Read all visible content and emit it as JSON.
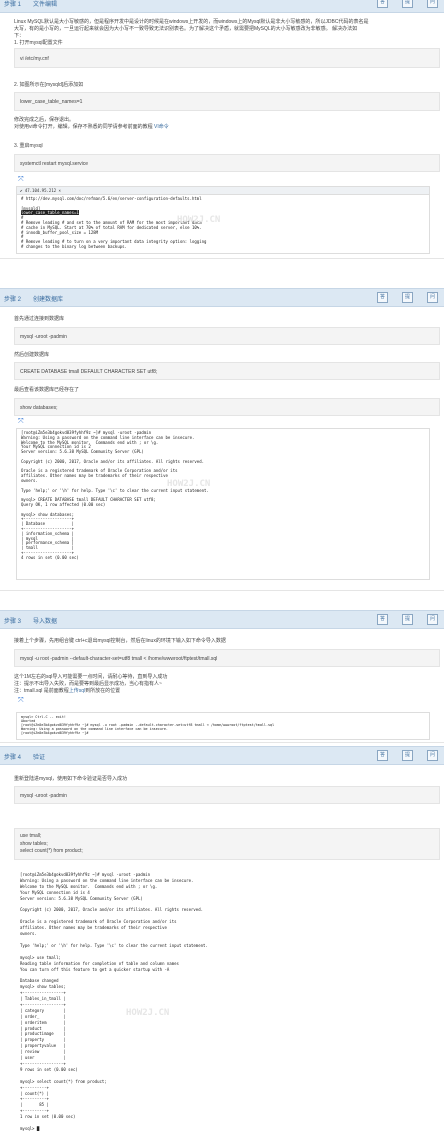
{
  "step1": {
    "num": "步骤 1",
    "title": "文件编辑",
    "lines": [
      "Linux MySQL默认是大小写敏感的，但是程序开发中是设计的时候是在windows上开发的，而windows上的Mysql默认是非大小写敏感的，所以JDBC代码的表名是",
      "大写，有的是小写的，一旦运行起来就会因为大小写不一致导致无法识别表名。为了解决这个矛盾，就需要把MySQL的大小写敏感改为非敏感。 解决办法如",
      "下：",
      "1. 打开mysql配置文件"
    ],
    "code1": "vi /etc/my.cnf",
    "line2": "2. 如图所示在[mysqld]后添加如",
    "code2": "lower_case_table_names=1",
    "line3a": "修改完成之后，保存退出。",
    "line3b_prefix": "对使用vi命令打开，编辑，保存不熟悉的同学请参考前面的教程 ",
    "line3b_link": "VI命令",
    "line4": "3. 重启mysql",
    "code3": "systemctl restart mysql.service",
    "shot_bar": "47.104.95.212",
    "shot_lines": [
      "# http://dev.mysql.com/doc/refman/5.6/en/server-configuration-defaults.html",
      "",
      "[mysqld]",
      "lower_case_table_names=1",
      "#",
      "# Remove leading # and set to the amount of RAM for the most important data",
      "# cache in MySQL. Start at 70% of total RAM for dedicated server, else 10%.",
      "# innodb_buffer_pool_size = 128M",
      "#",
      "# Remove leading # to turn on a very important data integrity option: logging",
      "# changes to the binary log between backups."
    ],
    "watermark": "HOW2J.CN"
  },
  "step2": {
    "num": "步骤 2",
    "title": "创建数据库",
    "line1": "首先通过连接到数据库",
    "code1": "mysql -uroot -padmin",
    "line2": "然后创建数据库",
    "code2": "CREATE DATABASE tmall DEFAULT CHARACTER SET utf8;",
    "line3": "最后查看该数据库已经存在了",
    "code3": "show databases;",
    "shot_lines": [
      "[root@iZm5e3b4gokvd839fyhhf9z ~]# mysql -uroot -padmin",
      "Warning: Using a password on the command line interface can be insecure.",
      "Welcome to the MySQL monitor.  Commands end with ; or \\g.",
      "Your MySQL connection id is 2",
      "Server version: 5.6.38 MySQL Community Server (GPL)",
      "",
      "Copyright (c) 2000, 2017, Oracle and/or its affiliates. All rights reserved.",
      "",
      "Oracle is a registered trademark of Oracle Corporation and/or its",
      "affiliates. Other names may be trademarks of their respective",
      "owners.",
      "",
      "Type 'help;' or '\\h' for help. Type '\\c' to clear the current input statement.",
      "",
      "mysql> CREATE DATABASE tmall DEFAULT CHARACTER SET utf8;",
      "Query OK, 1 row affected (0.00 sec)",
      "",
      "mysql> show databases;",
      "+--------------------+",
      "| Database           |",
      "+--------------------+",
      "| information_schema |",
      "| mysql              |",
      "| performance_schema |",
      "| tmall              |",
      "+--------------------+",
      "4 rows in set (0.00 sec)"
    ],
    "watermark": "HOW2J.CN"
  },
  "step3": {
    "num": "步骤 3",
    "title": "导入数据",
    "line1": "接着上个步骤，先用组合键 ctrl+c退出mysql控制台，然后在linux的环境下输入如下命令导入数据",
    "code1": "mysql -u root -padmin --default-character-set=utf8 tmall < /home/wwwroot/ftptest/tmall.sql",
    "line2": "这个1M左右的sql导入可能需要一点时间，请耐心等待，直到导入成功",
    "line3": "注：提示不出导入失败，而是要等到最后显示成功，当心有指有人~",
    "line4_prefix": "注：tmall.sql 是前面教程",
    "line4_link": "上传sql",
    "line4_suffix": "到所放在的位置",
    "shot_lines": [
      "mysql> Ctrl-C -- exit!",
      "Aborted",
      "[root@iZm5e3b4gokvd839fyhhf9z ~]# mysql -u root -padmin --default-character-set=utf8 tmall < /home/wwwroot/ftptest/tmall.sql",
      "Warning: Using a password on the command line interface can be insecure.",
      "[root@iZm5e3b4gokvd839fyhhf9z ~]#"
    ]
  },
  "step4": {
    "num": "步骤 4",
    "title": "验证",
    "line1": "重新登陆进mysql，使用如下命令验证是否导入成功",
    "code1": "mysql -uroot -padmin",
    "code2_lines": [
      "use tmall;",
      "show tables;",
      "select count(*) from product;"
    ],
    "shot_lines": [
      "[root@iZm5e3b4gokvd839fyhhf9z ~]# mysql -uroot -padmin",
      "Warning: Using a password on the command line interface can be insecure.",
      "Welcome to the MySQL monitor.  Commands end with ; or \\g.",
      "Your MySQL connection id is 4",
      "Server version: 5.6.38 MySQL Community Server (GPL)",
      "",
      "Copyright (c) 2000, 2017, Oracle and/or its affiliates. All rights reserved.",
      "",
      "Oracle is a registered trademark of Oracle Corporation and/or its",
      "affiliates. Other names may be trademarks of their respective",
      "owners.",
      "",
      "Type 'help;' or '\\h' for help. Type '\\c' to clear the current input statement.",
      "",
      "mysql> use tmall;",
      "Reading table information for completion of table and column names",
      "You can turn off this feature to get a quicker startup with -A",
      "",
      "Database changed",
      "mysql> show tables;",
      "+-----------------+",
      "| Tables_in_tmall |",
      "+-----------------+",
      "| category        |",
      "| order_          |",
      "| orderitem       |",
      "| product         |",
      "| productimage    |",
      "| property        |",
      "| propertyvalue   |",
      "| review          |",
      "| user            |",
      "+-----------------+",
      "9 rows in set (0.00 sec)",
      "",
      "mysql> select count(*) from product;",
      "+----------+",
      "| count(*) |",
      "+----------+",
      "|       85 |",
      "+----------+",
      "1 row in set (0.00 sec)",
      "",
      "mysql> "
    ],
    "watermark": "HOW2J.CN"
  },
  "header_icons": [
    "答",
    "提",
    "问"
  ]
}
